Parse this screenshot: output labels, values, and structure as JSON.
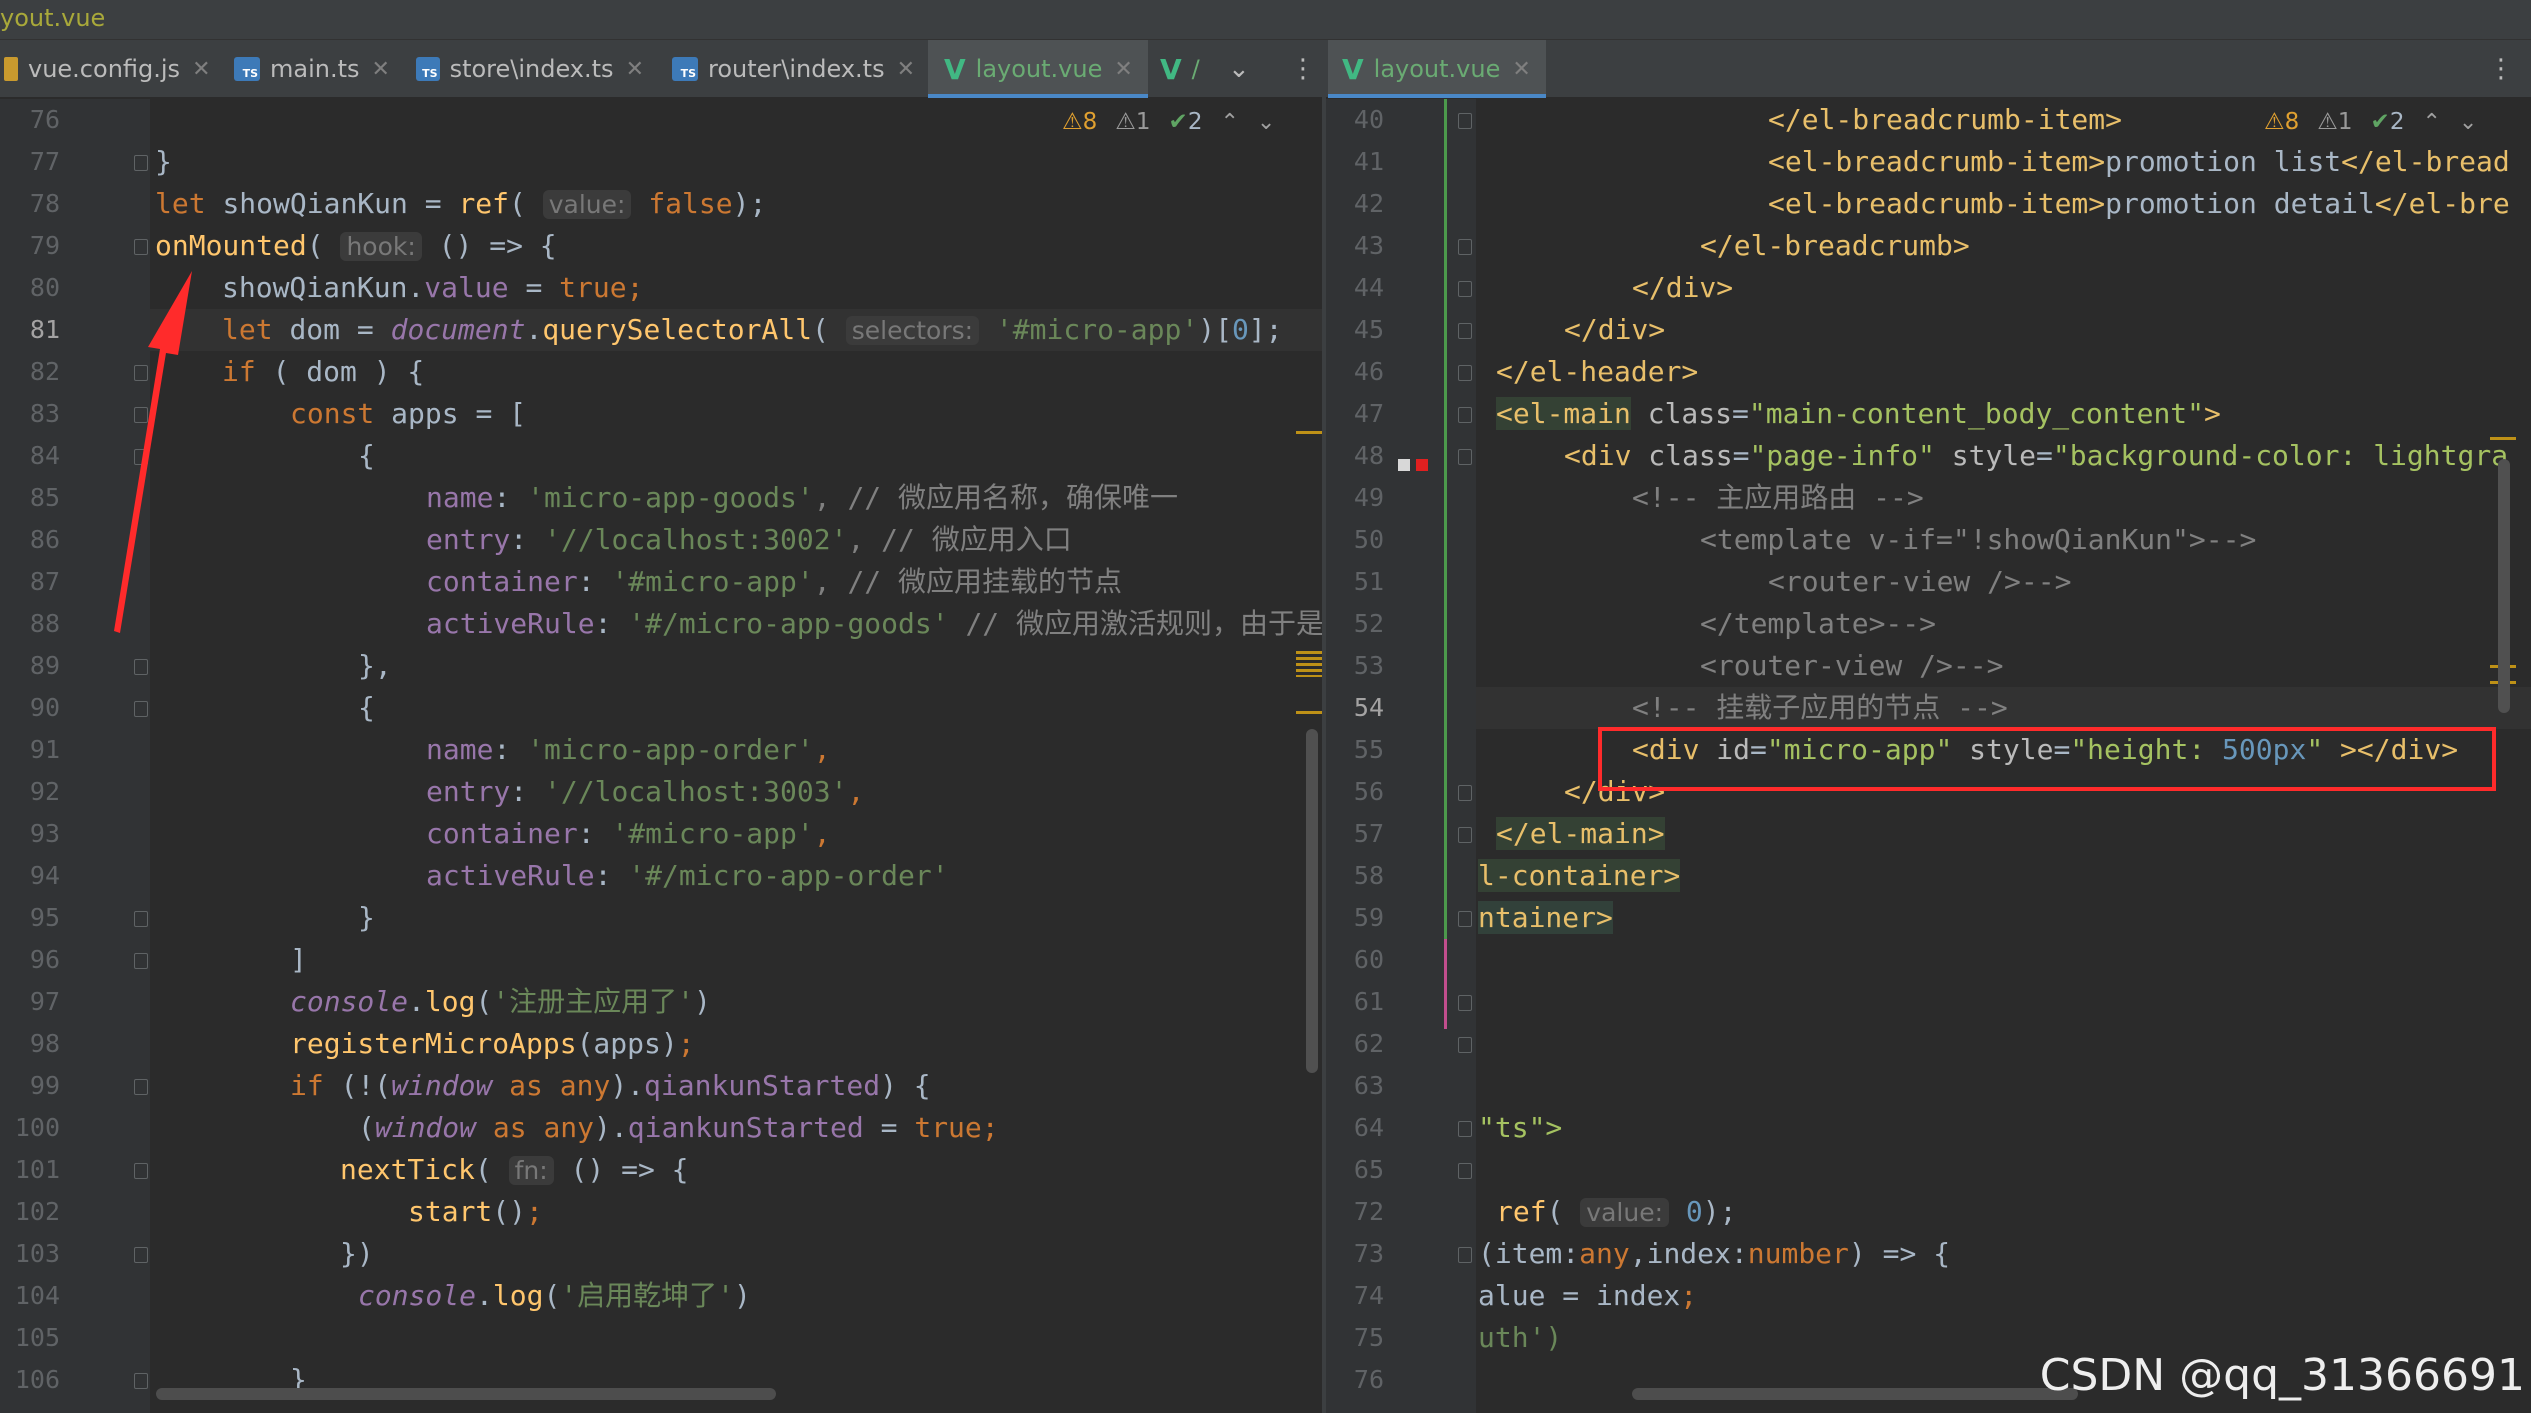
{
  "window": {
    "title_fragment": "yout.vue"
  },
  "left_tabs": [
    {
      "label": "vue.config.js",
      "icon": "js-file-icon"
    },
    {
      "label": "main.ts",
      "icon": "ts-file-icon"
    },
    {
      "label": "store\\index.ts",
      "icon": "ts-file-icon"
    },
    {
      "label": "router\\index.ts",
      "icon": "ts-file-icon"
    },
    {
      "label": "layout.vue",
      "icon": "vue-file-icon",
      "active": true
    },
    {
      "label": "/",
      "icon": "vue-file-icon"
    }
  ],
  "right_tabs": [
    {
      "label": "layout.vue",
      "icon": "vue-file-icon",
      "active": true
    }
  ],
  "left_inspection": {
    "warnings": "8",
    "weak_warnings": "1",
    "typos": "2"
  },
  "right_inspection": {
    "warnings": "8",
    "weak_warnings": "1",
    "typos": "2"
  },
  "left_lines": [
    "76",
    "77",
    "78",
    "79",
    "80",
    "81",
    "82",
    "83",
    "84",
    "85",
    "86",
    "87",
    "88",
    "89",
    "90",
    "91",
    "92",
    "93",
    "94",
    "95",
    "96",
    "97",
    "98",
    "99",
    "100",
    "101",
    "102",
    "103",
    "104",
    "105",
    "106"
  ],
  "left_code": {
    "l77": "}",
    "l78_let": "let ",
    "l78_var": "showQianKun",
    "l78_eq": " = ",
    "l78_fn": "ref",
    "l78_p": "( ",
    "l78_hint": "value:",
    "l78_val": " false",
    "l78_end": ");",
    "l79_fn": "onMounted",
    "l79_p": "( ",
    "l79_hint": "hook:",
    "l79_rest": " () => {",
    "l80_a": "showQianKun.",
    "l80_b": "value",
    "l80_c": " = ",
    "l80_d": "true",
    "l80_e": ";",
    "l81_let": "let ",
    "l81_a": "dom = ",
    "l81_doc": "document",
    "l81_dot": ".",
    "l81_fn": "querySelectorAll",
    "l81_p": "( ",
    "l81_hint": "selectors:",
    "l81_str": " '#micro-app'",
    "l81_b": ")[",
    "l81_num": "0",
    "l81_c": "];",
    "l82_if": "if",
    "l82_rest": " ( dom ) {",
    "l83_const": "const ",
    "l83_rest": "apps = [",
    "l84": "{",
    "l85_k": "name",
    "l85_c": ": ",
    "l85_s": "'micro-app-goods'",
    "l85_cm": ", // 微应用名称，确保唯一",
    "l86_k": "entry",
    "l86_c": ": ",
    "l86_s": "'//localhost:3002'",
    "l86_cm": ", // 微应用入口",
    "l87_k": "container",
    "l87_c": ": ",
    "l87_s": "'#micro-app'",
    "l87_cm": ", // 微应用挂载的节点",
    "l88_k": "activeRule",
    "l88_c": ": ",
    "l88_s": "'#/micro-app-goods'",
    "l88_cm": " // 微应用激活规则，由于是",
    "l89": "},",
    "l90": "{",
    "l91_k": "name",
    "l91_c": ": ",
    "l91_s": "'micro-app-order'",
    "l91_e": ",",
    "l92_k": "entry",
    "l92_c": ": ",
    "l92_s": "'//localhost:3003'",
    "l92_e": ",",
    "l93_k": "container",
    "l93_c": ": ",
    "l93_s": "'#micro-app'",
    "l93_e": ",",
    "l94_k": "activeRule",
    "l94_c": ": ",
    "l94_s": "'#/micro-app-order'",
    "l95": "}",
    "l96": "]",
    "l97_obj": "console",
    "l97_dot": ".",
    "l97_fn": "log",
    "l97_p": "(",
    "l97_s": "'注册主应用了'",
    "l97_e": ")",
    "l98_fn": "registerMicroApps",
    "l98_rest": "(apps)",
    "l98_e": ";",
    "l99_if": "if",
    "l99_a": " (!(",
    "l99_w": "window",
    "l99_as": " as ",
    "l99_any": "any",
    "l99_b": ").",
    "l99_p": "qiankunStarted",
    "l99_c": ") {",
    "l100_a": "(",
    "l100_w": "window",
    "l100_as": " as ",
    "l100_any": "any",
    "l100_b": ").",
    "l100_p": "qiankunStarted",
    "l100_c": " = ",
    "l100_t": "true",
    "l100_e": ";",
    "l101_fn": "nextTick",
    "l101_p": "( ",
    "l101_hint": "fn:",
    "l101_rest": " () => {",
    "l102_fn": "start",
    "l102_p": "()",
    "l102_e": ";",
    "l103": "})",
    "l104_obj": "console",
    "l104_dot": ".",
    "l104_fn": "log",
    "l104_p": "(",
    "l104_s": "'启用乾坤了'",
    "l104_e": ")",
    "l106": "}"
  },
  "right_lines": [
    "40",
    "41",
    "42",
    "43",
    "44",
    "45",
    "46",
    "47",
    "48",
    "49",
    "50",
    "51",
    "52",
    "53",
    "54",
    "55",
    "56",
    "57",
    "58",
    "59",
    "60",
    "61",
    "62",
    "63",
    "64",
    "65",
    "72",
    "73",
    "74",
    "75",
    "76"
  ],
  "right_code": {
    "r40": "</el-breadcrumb-item>",
    "r41_t": "<el-breadcrumb-item>",
    "r41_x": "promotion list",
    "r41_e": "</el-bread",
    "r42_t": "<el-breadcrumb-item>",
    "r42_x": "promotion detail",
    "r42_e": "</el-bre",
    "r43": "</el-breadcrumb>",
    "r44": "</div>",
    "r45": "</div>",
    "r46": "</el-header>",
    "r47_t": "<el-main",
    "r47_a": " class",
    "r47_eq": "=",
    "r47_v": "\"main-content_body_content\"",
    "r47_e": ">",
    "r48_t": "<div",
    "r48_a": " class",
    "r48_eq": "=",
    "r48_v": "\"page-info\"",
    "r48_a2": " style",
    "r48_eq2": "=",
    "r48_v2": "\"background-color: lightgra",
    "r49": "<!-- 主应用路由 -->",
    "r50": "<template v-if=\"!showQianKun\">-->",
    "r51": "<router-view />-->",
    "r52": "</template>-->",
    "r53": "<router-view />-->",
    "r54": "<!-- 挂载子应用的节点 -->",
    "r55_t": "<div",
    "r55_a": " id",
    "r55_eq": "=",
    "r55_v": "\"micro-app\"",
    "r55_a2": " style",
    "r55_eq2": "=",
    "r55_v2a": "\"height: ",
    "r55_num": "500px",
    "r55_v2b": "\"",
    "r55_e": " ></div>",
    "r56": "</div>",
    "r57": "</el-main>",
    "r58": "l-container>",
    "r59": "ntainer>",
    "r64": "\"ts\">",
    "r72_fn": "ref",
    "r72_p": "( ",
    "r72_hint": "value:",
    "r72_num": " 0",
    "r72_e": ");",
    "r73_a": "(item:",
    "r73_t1": "any",
    "r73_b": ",index:",
    "r73_t2": "number",
    "r73_c": ") => {",
    "r74_a": "alue = index",
    "r74_e": ";",
    "r75": "uth')"
  },
  "watermark": "CSDN @qq_31366691",
  "colors": {
    "keyword": "#cc7832",
    "string": "#6a8759",
    "function": "#ffc66d",
    "number": "#6897bb",
    "property": "#9876aa",
    "tag": "#e8bf6a",
    "annotation": "#ff2b2b"
  }
}
